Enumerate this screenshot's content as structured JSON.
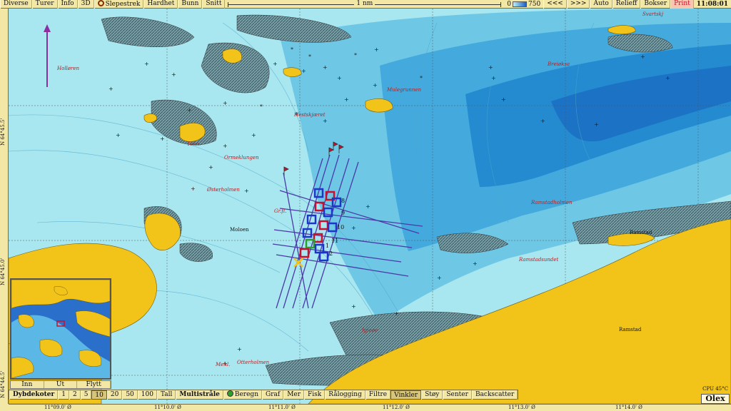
{
  "toolbar": {
    "items": [
      "Diverse",
      "Turer",
      "Info",
      "3D",
      "Slepestrek",
      "Hardhet",
      "Bunn",
      "Snitt"
    ],
    "scale_label": "1 nm",
    "depth_min": "0",
    "depth_max": "750",
    "nav_back": "<<<",
    "nav_fwd": ">>>",
    "auto": "Auto",
    "relief": "Relieff",
    "boxes": "Bokser",
    "print": "Print",
    "clock": "11:08:01"
  },
  "rulers": {
    "lat": [
      "N 64°45.5'",
      "N 64°45.0'",
      "N 64°44.5'"
    ],
    "lon": [
      "11°09.0' Ø",
      "11°10.0' Ø",
      "11°11.0' Ø",
      "11°12.0' Ø",
      "11°13.0' Ø",
      "11°14.0' Ø"
    ]
  },
  "places": {
    "hollaren": "Holløren",
    "breioksa": "Breiøksa",
    "ormeklungen": "Ormeklungen",
    "osterholm": "Østerholmen",
    "ramstadholm": "Ramstadholmen",
    "ramstadsundet": "Ramstadsundet",
    "ramstad1": "Ramstad",
    "ramstad2": "Ramstad",
    "igleoe": "Igleøe",
    "mehl": "Mehl.",
    "otterholmen": "Otterholmen",
    "svartskj": "Svartskj",
    "tekn": "Tekn.",
    "grunn": "Gr.fl.",
    "mule": "Mulegrunnen",
    "hestskjer": "Hestskjæret",
    "mooring": "Moloen"
  },
  "labels": {
    "n1": "1",
    "n2": "2",
    "n8": "8",
    "n9": "9",
    "n10": "10",
    "n11": "11"
  },
  "minimap": {
    "buttons": [
      "Inn",
      "Ut",
      "Flytt"
    ]
  },
  "bottombar": {
    "depth_label": "Dybdekoter",
    "depth_values": [
      "1",
      "2",
      "5",
      "10",
      "20",
      "50",
      "100",
      "Tall"
    ],
    "selected_depth": "10",
    "multibeam_label": "Multistråle",
    "buttons": [
      "Beregn",
      "Graf",
      "Mer",
      "Fisk",
      "Rålogging",
      "Filtre",
      "Vinkler",
      "Støy",
      "Senter",
      "Backscatter"
    ],
    "selected_buttons": [
      "Vinkler"
    ]
  },
  "status": {
    "cpu": "CPU 45°C",
    "brand": "Olex"
  },
  "colors": {
    "land": "#f2c41a",
    "shallow": "#9fe3ef",
    "deep": "#1e8fd0",
    "track": "#4a3aa8",
    "marker_blue": "#1d35c9",
    "marker_red": "#c8102e",
    "marker_green": "#2ca02c"
  }
}
